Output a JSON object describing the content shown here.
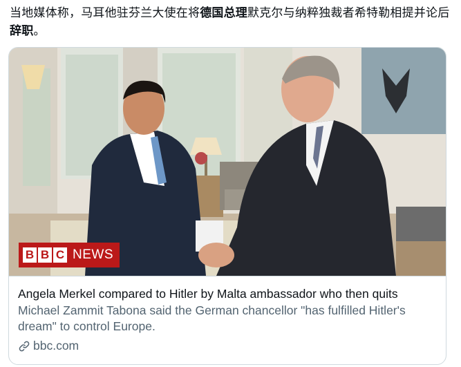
{
  "tweet": {
    "text_part1": "当地媒体称，马耳他驻芬兰大使在将",
    "text_bold1": "德国总理",
    "text_part2": "默克尔与纳粹独裁者希特勒相提并论后",
    "text_bold2": "辞职",
    "text_part3": "。"
  },
  "card": {
    "badge_letters": [
      "B",
      "B",
      "C"
    ],
    "badge_news": "NEWS",
    "title": "Angela Merkel compared to Hitler by Malta ambassador who then quits",
    "description": "Michael Zammit Tabona said the German chancellor \"has fulfilled Hitler's dream\" to control Europe.",
    "domain": "bbc.com",
    "domain_icon": "link-icon"
  },
  "colors": {
    "bbc_red": "#bb1919",
    "border": "#cfd9de",
    "secondary_text": "#536471",
    "primary_text": "#0f1419"
  }
}
